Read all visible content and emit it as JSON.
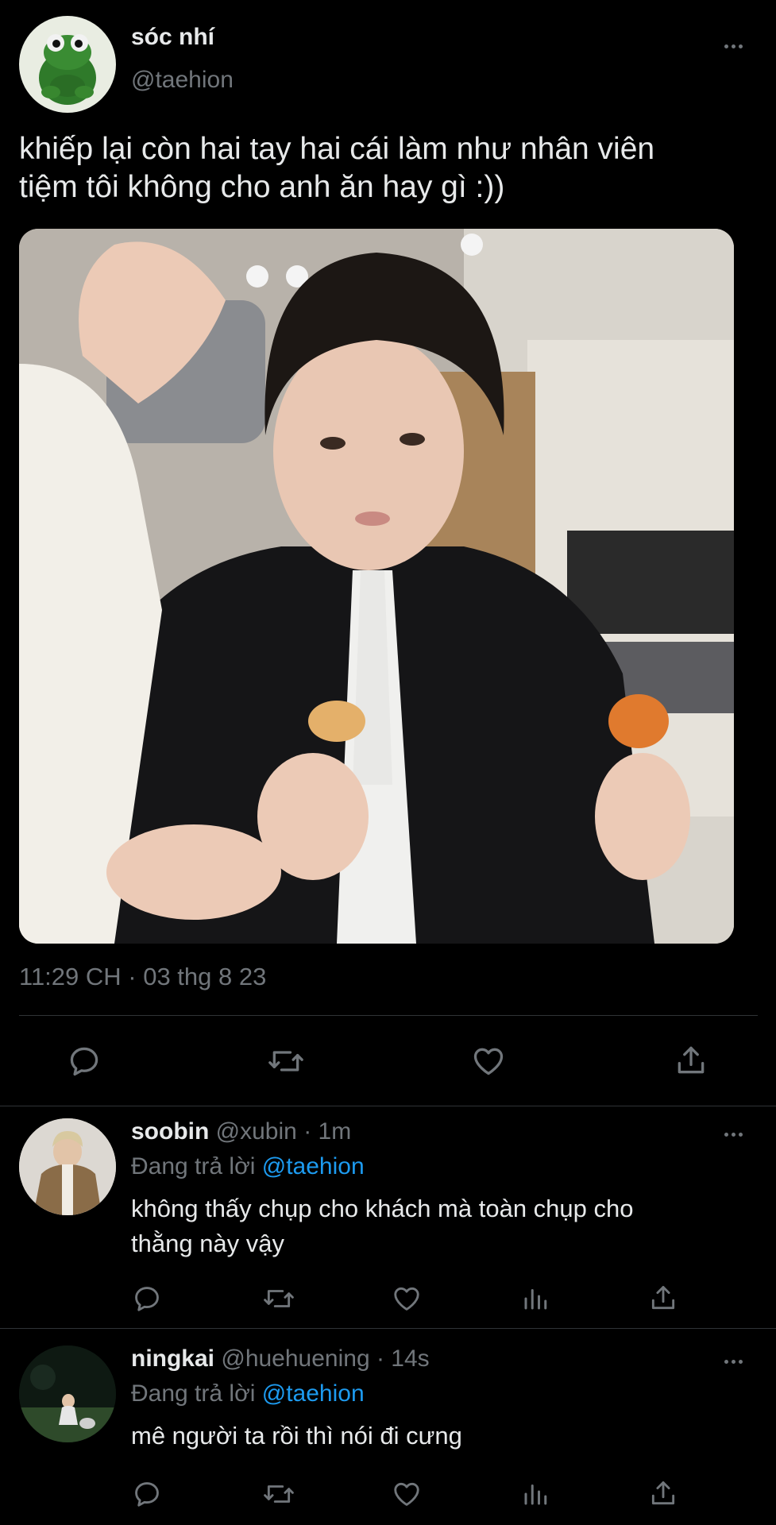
{
  "main_tweet": {
    "display_name": "sóc nhí",
    "handle": "@taehion",
    "text_line1": "khiếp lại còn hai tay hai cái làm như nhân viên",
    "text_line2": "tiệm tôi không cho anh ăn hay gì :))",
    "timestamp": "11:29 CH · 03 thg 8 23",
    "actions": [
      "reply-icon",
      "retweet-icon",
      "like-icon",
      "share-icon"
    ]
  },
  "replies": [
    {
      "display_name": "soobin",
      "handle": "@xubin",
      "time": "· 1m",
      "replying_prefix": "Đang trả lời",
      "replying_to": "@taehion",
      "text_line1": "không thấy chụp cho khách mà toàn chụp cho",
      "text_line2": "thằng này vậy"
    },
    {
      "display_name": "ningkai",
      "handle": "@huehuening",
      "time": "· 14s",
      "replying_prefix": "Đang trả lời",
      "replying_to": "@taehion",
      "text_line1": "mê người ta rồi thì nói đi cưng"
    }
  ],
  "colors": {
    "background": "#000000",
    "text": "#e7e9ea",
    "muted": "#71767b",
    "link": "#1d9bf0",
    "divider": "#2f3336"
  }
}
